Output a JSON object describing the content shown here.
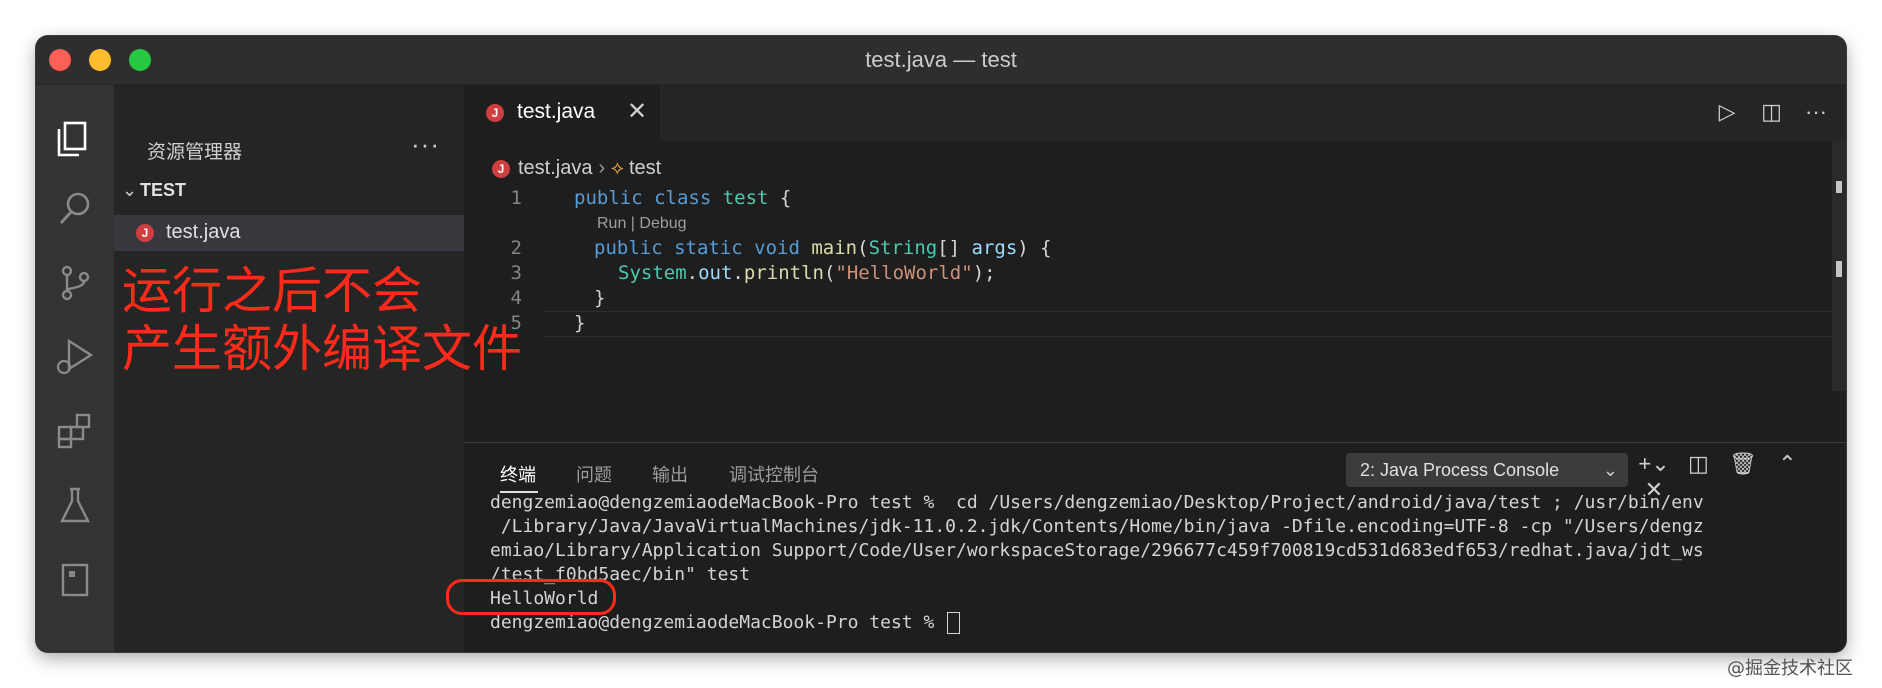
{
  "window": {
    "title": "test.java — test"
  },
  "activity_bar": [
    "files-icon",
    "search-icon",
    "source-control-icon",
    "run-debug-icon",
    "extensions-icon",
    "testing-icon",
    "panel-icon"
  ],
  "sidebar": {
    "title": "资源管理器",
    "more": "···",
    "section": "TEST",
    "file": "test.java"
  },
  "annotation": {
    "line1": "运行之后不会",
    "line2": "产生额外编译文件"
  },
  "editor": {
    "tab": {
      "label": "test.java",
      "close": "✕"
    },
    "breadcrumb": {
      "file": "test.java",
      "symbol": "test"
    },
    "codelens": "Run | Debug",
    "line_numbers": [
      "1",
      "2",
      "3",
      "4",
      "5"
    ],
    "lines": {
      "l1_kw": "public class ",
      "l1_name": "test",
      "l1_rest": " {",
      "l2_kw": "public static void ",
      "l2_fn": "main",
      "l2_p1": "(",
      "l2_type": "String",
      "l2_p2": "[] ",
      "l2_var": "args",
      "l2_rest": ") {",
      "l3_cls": "System",
      "l3_dot": ".",
      "l3_out": "out",
      "l3_dot2": ".",
      "l3_fn": "println",
      "l3_p1": "(",
      "l3_str": "\"HelloWorld\"",
      "l3_rest": ");",
      "l4": "}",
      "l5": "}"
    }
  },
  "panel": {
    "tabs": [
      "终端",
      "问题",
      "输出",
      "调试控制台"
    ],
    "active_tab": "终端",
    "select": "2: Java Process Console",
    "terminal_lines": [
      "dengzemiao@dengzemiaodeMacBook-Pro test %  cd /Users/dengzemiao/Desktop/Project/android/java/test ; /usr/bin/env",
      " /Library/Java/JavaVirtualMachines/jdk-11.0.2.jdk/Contents/Home/bin/java -Dfile.encoding=UTF-8 -cp \"/Users/dengz",
      "emiao/Library/Application Support/Code/User/workspaceStorage/296677c459f700819cd531d683edf653/redhat.java/jdt_ws",
      "/test_f0bd5aec/bin\" test",
      "HelloWorld",
      "dengzemiao@dengzemiaodeMacBook-Pro test % "
    ]
  },
  "watermark": "@掘金技术社区"
}
